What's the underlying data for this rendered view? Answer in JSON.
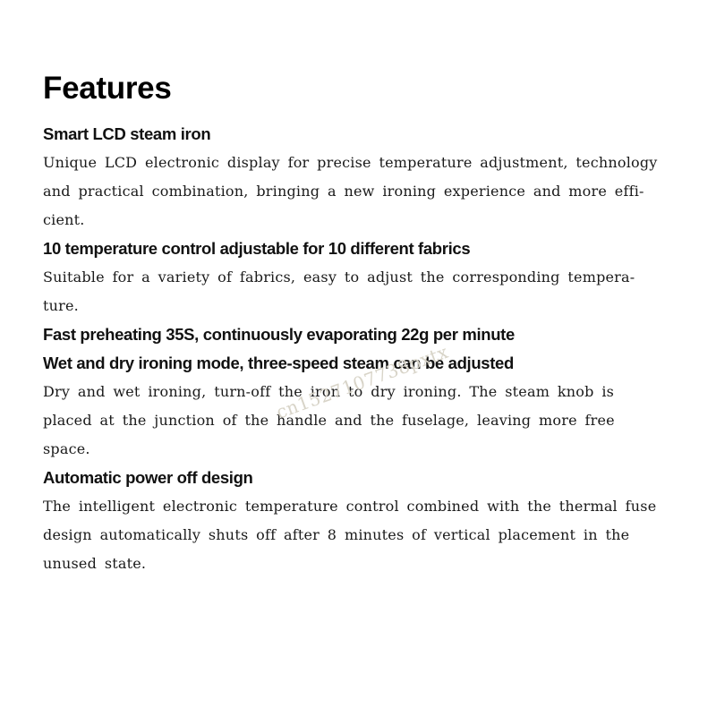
{
  "page": {
    "title": "Features",
    "background_color": "#ffffff",
    "text_color": "#1a1a1a",
    "heading_color": "#111111"
  },
  "watermark": {
    "text": "cn1527107738pxtx",
    "color": "#d8d4c8",
    "rotation_degrees": -20
  },
  "sections": [
    {
      "heading": "Smart LCD steam iron",
      "body_lines": [
        "Unique LCD electronic display for precise temperature adjustment, technology",
        "and practical combination, bringing a new ironing experience and more effi-",
        "cient."
      ]
    },
    {
      "heading": "10 temperature control adjustable for 10 different fabrics",
      "body_lines": [
        "Suitable for a variety of fabrics, easy to adjust the corresponding tempera-",
        "ture."
      ]
    },
    {
      "heading": "Fast preheating 35S, continuously evaporating 22g per minute",
      "body_lines": []
    },
    {
      "heading": "Wet and dry ironing mode, three-speed steam can be adjusted",
      "body_lines": [
        "Dry and wet ironing, turn-off the iron to dry ironing. The steam knob is",
        "placed at the junction of the handle and the fuselage, leaving more free",
        "space."
      ]
    },
    {
      "heading": "Automatic power off design",
      "body_lines": [
        "The intelligent electronic temperature control combined with the thermal fuse",
        "design automatically shuts off after 8 minutes of vertical placement in the",
        "unused state."
      ]
    }
  ]
}
